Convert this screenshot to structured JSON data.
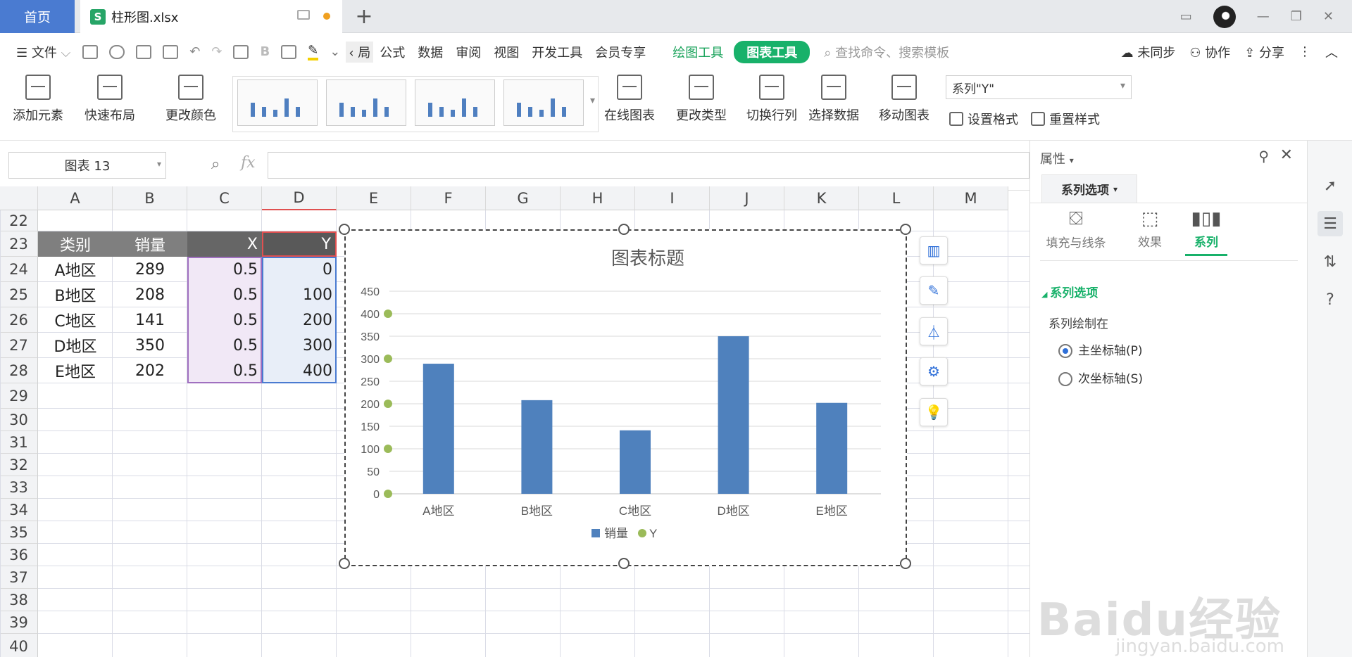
{
  "tabs": {
    "home": "首页",
    "file": "柱形图.xlsx",
    "add": "+"
  },
  "menu": {
    "file": "文件",
    "items": [
      "局",
      "公式",
      "数据",
      "审阅",
      "视图",
      "开发工具",
      "会员专享"
    ],
    "drawing_tools": "绘图工具",
    "chart_tools": "图表工具",
    "search": "查找命令、搜索模板",
    "unsynced": "未同步",
    "collab": "协作",
    "share": "分享"
  },
  "ribbon": {
    "add_element": "添加元素",
    "quick_layout": "快速布局",
    "change_color": "更改颜色",
    "online_chart": "在线图表",
    "change_type": "更改类型",
    "switch_rowcol": "切换行列",
    "select_data": "选择数据",
    "move_chart": "移动图表",
    "series_select": "系列\"Y\"",
    "set_format": "设置格式",
    "reset_style": "重置样式"
  },
  "formula_bar": {
    "name_box": "图表 13",
    "fx": "fx",
    "value": ""
  },
  "columns": [
    "A",
    "B",
    "C",
    "D",
    "E",
    "F",
    "G",
    "H",
    "I",
    "J",
    "K",
    "L",
    "M"
  ],
  "rows": [
    "22",
    "23",
    "24",
    "25",
    "26",
    "27",
    "28",
    "29",
    "30",
    "31",
    "32",
    "33",
    "34",
    "35",
    "36",
    "37",
    "38",
    "39",
    "40"
  ],
  "table": {
    "headers": [
      "类别",
      "销量",
      "X",
      "Y"
    ],
    "rows": [
      [
        "A地区",
        "289",
        "0.5",
        "0"
      ],
      [
        "B地区",
        "208",
        "0.5",
        "100"
      ],
      [
        "C地区",
        "141",
        "0.5",
        "200"
      ],
      [
        "D地区",
        "350",
        "0.5",
        "300"
      ],
      [
        "E地区",
        "202",
        "0.5",
        "400"
      ]
    ]
  },
  "chart_data": {
    "type": "bar",
    "title": "图表标题",
    "categories": [
      "A地区",
      "B地区",
      "C地区",
      "D地区",
      "E地区"
    ],
    "series": [
      {
        "name": "销量",
        "type": "bar",
        "values": [
          289,
          208,
          141,
          350,
          202
        ],
        "color": "#4f81bd"
      },
      {
        "name": "Y",
        "type": "scatter",
        "x": [
          0.5,
          0.5,
          0.5,
          0.5,
          0.5
        ],
        "values": [
          0,
          100,
          200,
          300,
          400
        ],
        "color": "#9bbb59"
      }
    ],
    "yticks": [
      "450",
      "400",
      "350",
      "300",
      "250",
      "200",
      "150",
      "100",
      "50",
      "0"
    ],
    "ylim": [
      0,
      450
    ],
    "grid": true,
    "legend": "bottom"
  },
  "panel": {
    "title": "属性",
    "dropdown": "系列选项",
    "tabs": [
      "填充与线条",
      "效果",
      "系列"
    ],
    "section": "系列选项",
    "plot_on": "系列绘制在",
    "primary_axis": "主坐标轴(P)",
    "secondary_axis": "次坐标轴(S)"
  },
  "watermark": {
    "main": "Baidu经验",
    "sub": "jingyan.baidu.com"
  },
  "colors": {
    "accent_blue": "#4a7bd1",
    "green": "#18b16a",
    "bar": "#4f81bd",
    "marker": "#9bbb59",
    "header_dark": "#595959"
  }
}
